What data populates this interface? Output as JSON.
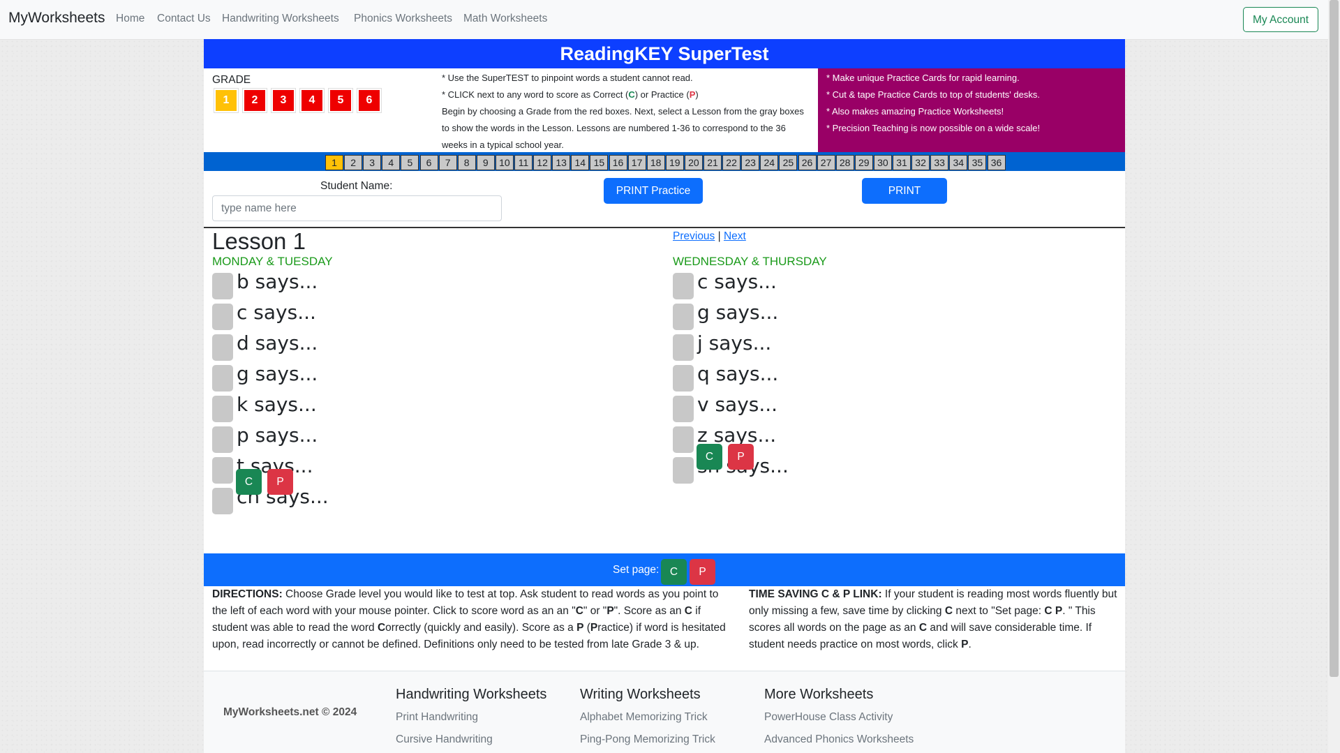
{
  "nav": {
    "brand": "MyWorksheets",
    "links": [
      "Home",
      "Contact Us",
      "Handwriting Worksheets",
      "Phonics Worksheets",
      "Math Worksheets"
    ],
    "account": "My Account"
  },
  "header": {
    "title": "ReadingKEY SuperTest"
  },
  "grade": {
    "label": "GRADE",
    "options": [
      "1",
      "2",
      "3",
      "4",
      "5",
      "6"
    ],
    "selected": "1"
  },
  "instructions": {
    "line1": "* Use the SuperTEST to pinpoint words a student cannot read.",
    "line2_pre": "* CLICK next to any word to score as Correct (",
    "line2_c": "C",
    "line2_mid": ") or Practice (",
    "line2_p": "P",
    "line2_post": ")",
    "para": "Begin by choosing a Grade from the red boxes. Next, select a Lesson from the gray boxes to show the words in the Lesson. Lessons are numbered 1-36 to correspond to the 36 weeks in a typical school year."
  },
  "promo": [
    "* Make unique Practice Cards for rapid learning.",
    "* Cut & tape Practice Cards to top of students' desks.",
    "* Also makes amazing Practice Worksheets!",
    "* Precision Teaching is now possible on a wide scale!"
  ],
  "lessons": {
    "numbers": [
      "1",
      "2",
      "3",
      "4",
      "5",
      "6",
      "7",
      "8",
      "9",
      "10",
      "11",
      "12",
      "13",
      "14",
      "15",
      "16",
      "17",
      "18",
      "19",
      "20",
      "21",
      "22",
      "23",
      "24",
      "25",
      "26",
      "27",
      "28",
      "29",
      "30",
      "31",
      "32",
      "33",
      "34",
      "35",
      "36"
    ],
    "selected": "1"
  },
  "controls": {
    "student_label": "Student Name:",
    "student_placeholder": "type name here",
    "print_cards": "PRINT Practice Cards",
    "print_worksheet": "PRINT Worksheet"
  },
  "lesson": {
    "title": "Lesson 1",
    "previous": "Previous",
    "separator": "|",
    "next": "Next",
    "left_heading": "MONDAY & TUESDAY",
    "right_heading": "WEDNESDAY & THURSDAY",
    "left_words": [
      "b says...",
      "c says...",
      "d says...",
      "g says...",
      "k says...",
      "p says...",
      "t says...",
      "ch says..."
    ],
    "right_words": [
      "c says...",
      "g says...",
      "j says...",
      "q says...",
      "v says...",
      "z says...",
      "sh says..."
    ],
    "c_label": "C",
    "p_label": "P"
  },
  "setpage": {
    "label": "Set page:",
    "c": "C",
    "p": "P"
  },
  "directions": {
    "left_bold": "DIRECTIONS:",
    "left_a": " Choose Grade level you would like to test at top. Ask student to read words as you point to the left of each word with your mouse pointer. Click to score word as an an \"",
    "left_c": "C",
    "left_b": "\" or \"",
    "left_p": "P",
    "left_c2_pre": "\". Score as an ",
    "left_c2": "C",
    "left_d": " if student was able to read the word ",
    "left_c3": "C",
    "left_e": "orrectly (quickly and easily). Score as a ",
    "left_p2": "P",
    "left_f": " (",
    "left_p3": "P",
    "left_g": "ractice) if word is hesitated upon, read incorrectly or cannot be defined. Definitions only need to be tested from late Grade 3 & up.",
    "right_bold": "TIME SAVING C & P LINK:",
    "right_a": " If your student is reading most words fluently but only missing a few, save time by clicking ",
    "right_c": "C",
    "right_b": " next to \"Set page: ",
    "right_cp": "C P",
    "right_c_post": ". \" This scores all words on the page as an ",
    "right_c2": "C",
    "right_d": " and will save considerable time. If student needs practice on most words, click ",
    "right_p": "P",
    "right_e": "."
  },
  "footer": {
    "copyright": "MyWorksheets.net © 2024",
    "col1": {
      "heading": "Handwriting Worksheets",
      "links": [
        "Print Handwriting",
        "Cursive Handwriting"
      ]
    },
    "col2": {
      "heading": "Writing Worksheets",
      "links": [
        "Alphabet Memorizing Trick",
        "Ping-Pong Memorizing Trick"
      ]
    },
    "col3": {
      "heading": "More Worksheets",
      "links": [
        "PowerHouse Class Activity",
        "Advanced Phonics Worksheets"
      ]
    }
  }
}
